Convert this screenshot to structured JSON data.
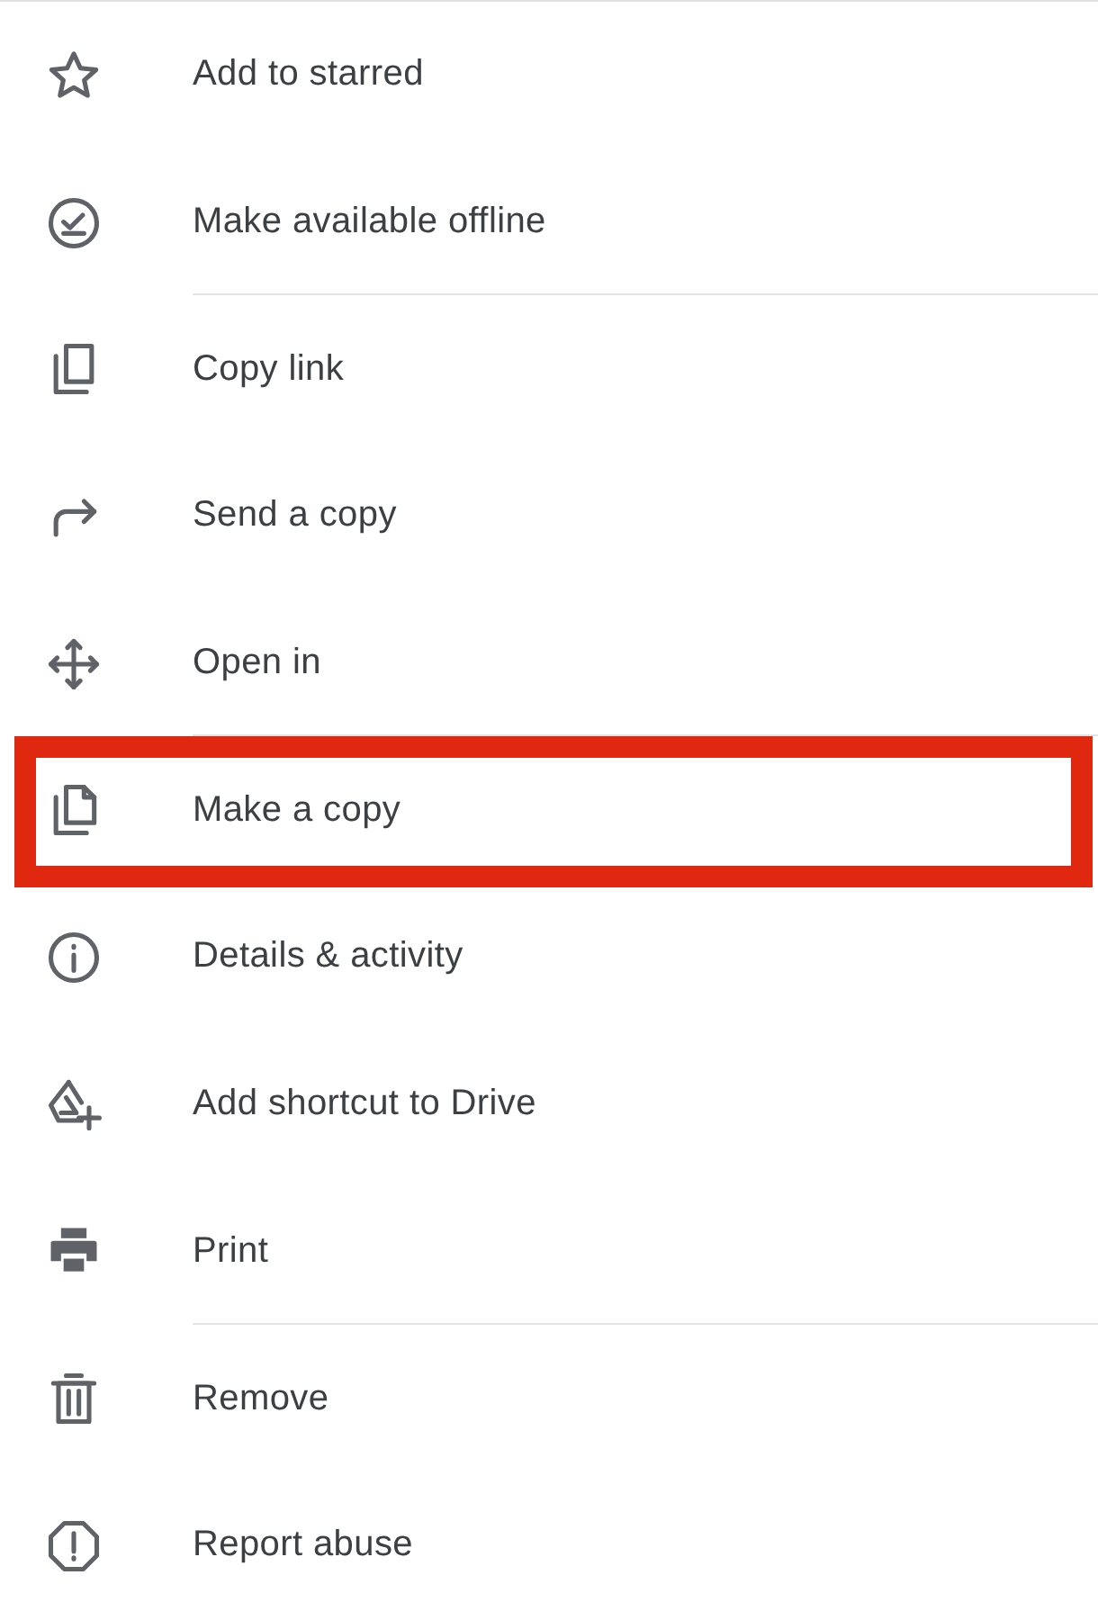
{
  "menu": {
    "items": [
      {
        "kind": "star",
        "label": "Add to starred",
        "highlighted": false,
        "divider_after": false
      },
      {
        "kind": "offline",
        "label": "Make available offline",
        "highlighted": false,
        "divider_after": true
      },
      {
        "kind": "copy-link",
        "label": "Copy link",
        "highlighted": false,
        "divider_after": false
      },
      {
        "kind": "send",
        "label": "Send a copy",
        "highlighted": false,
        "divider_after": false
      },
      {
        "kind": "open",
        "label": "Open in",
        "highlighted": false,
        "divider_after": true
      },
      {
        "kind": "make-copy",
        "label": "Make a copy",
        "highlighted": true,
        "divider_after": false
      },
      {
        "kind": "info",
        "label": "Details & activity",
        "highlighted": false,
        "divider_after": false
      },
      {
        "kind": "shortcut",
        "label": "Add shortcut to Drive",
        "highlighted": false,
        "divider_after": false
      },
      {
        "kind": "print",
        "label": "Print",
        "highlighted": false,
        "divider_after": true
      },
      {
        "kind": "trash",
        "label": "Remove",
        "highlighted": false,
        "divider_after": false
      },
      {
        "kind": "report",
        "label": "Report abuse",
        "highlighted": false,
        "divider_after": false
      }
    ]
  }
}
